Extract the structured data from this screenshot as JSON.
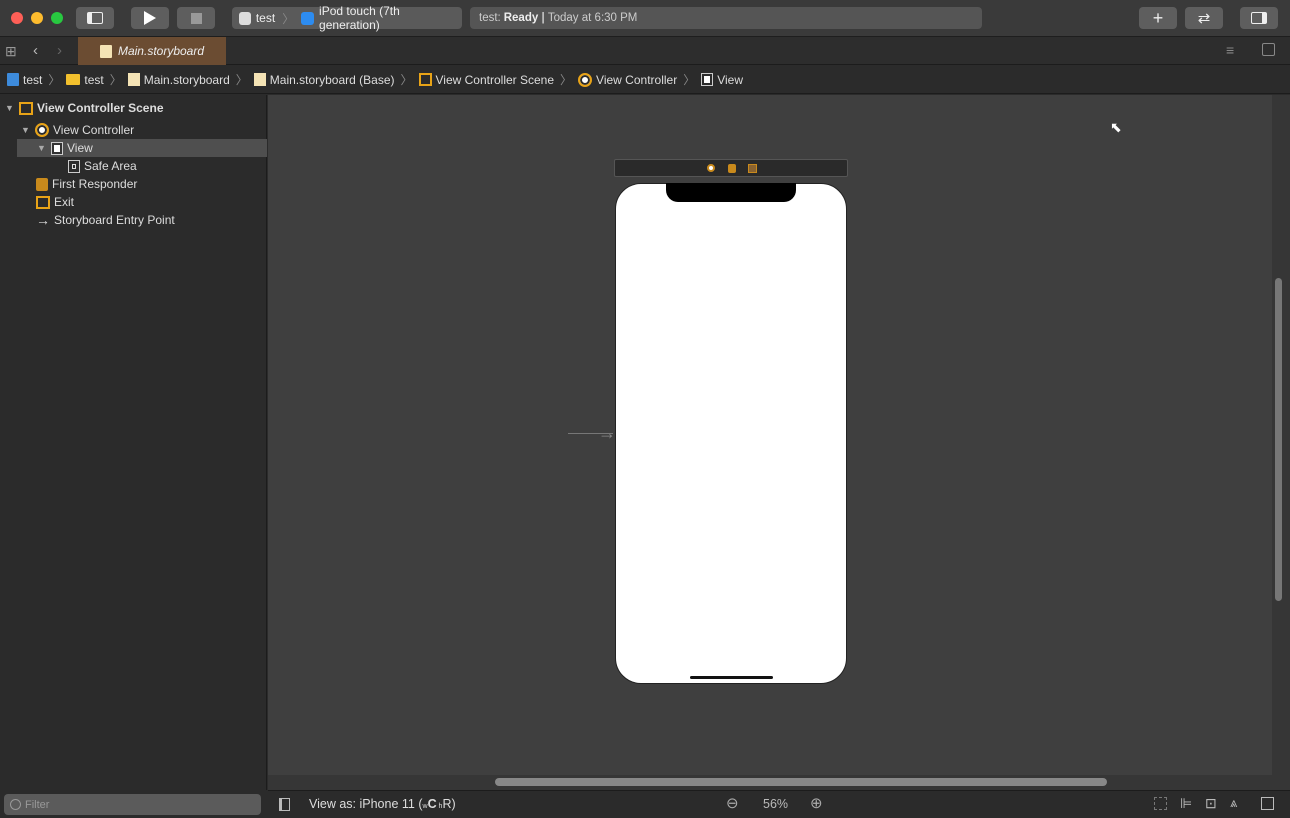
{
  "toolbar": {
    "scheme_project": "test",
    "scheme_device": "iPod touch (7th generation)",
    "status_prefix": "test: ",
    "status_state": "Ready",
    "status_sep": " | ",
    "status_time": "Today at 6:30 PM"
  },
  "tab": {
    "label": "Main.storyboard"
  },
  "breadcrumb": [
    "test",
    "test",
    "Main.storyboard",
    "Main.storyboard (Base)",
    "View Controller Scene",
    "View Controller",
    "View"
  ],
  "outline": {
    "items": [
      "View Controller Scene",
      "View Controller",
      "View",
      "Safe Area",
      "First Responder",
      "Exit",
      "Storyboard Entry Point"
    ]
  },
  "filter": {
    "placeholder": "Filter"
  },
  "bottom": {
    "view_as": "View as: iPhone 11 (",
    "w": "w",
    "c": "C",
    "h": " h",
    "r": "R)",
    "zoom": "56%"
  },
  "colors": {
    "accent": "#e8a317",
    "tab": "#6b4c32"
  }
}
